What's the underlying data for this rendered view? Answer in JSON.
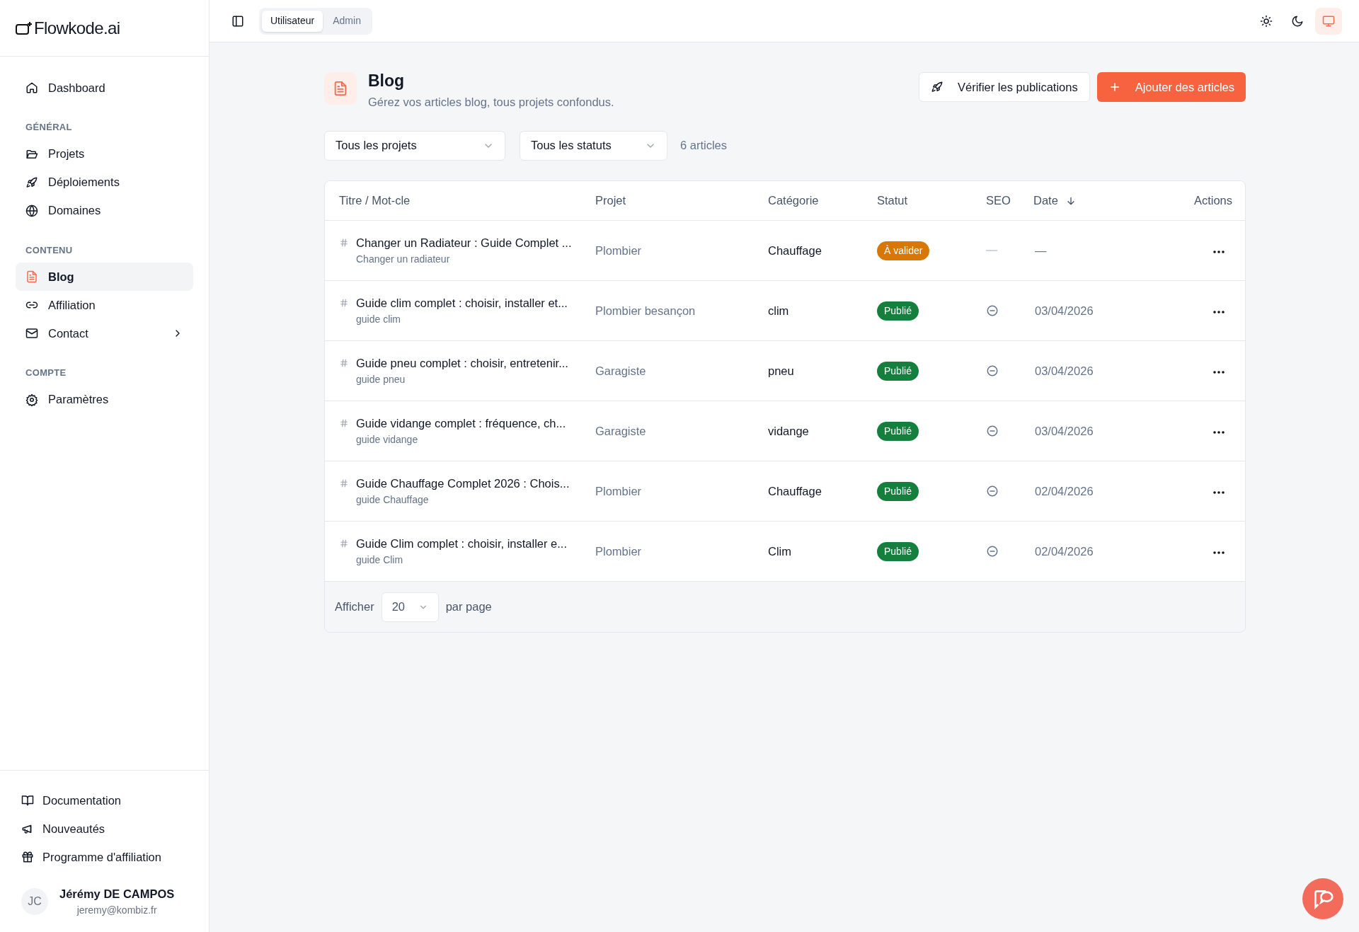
{
  "logo": "Flowkode.ai",
  "sidebar": {
    "top_item": {
      "label": "Dashboard",
      "selected": false
    },
    "sections": [
      {
        "heading": "GÉNÉRAL",
        "items": [
          {
            "label": "Projets",
            "selected": false,
            "has_submenu": false
          },
          {
            "label": "Déploiements",
            "selected": false,
            "has_submenu": false
          },
          {
            "label": "Domaines",
            "selected": false,
            "has_submenu": false
          }
        ]
      },
      {
        "heading": "CONTENU",
        "items": [
          {
            "label": "Blog",
            "selected": true,
            "has_submenu": false
          },
          {
            "label": "Affiliation",
            "selected": false,
            "has_submenu": false
          },
          {
            "label": "Contact",
            "selected": false,
            "has_submenu": true
          }
        ]
      },
      {
        "heading": "COMPTE",
        "items": [
          {
            "label": "Paramètres",
            "selected": false,
            "has_submenu": false
          }
        ]
      }
    ],
    "footer_links": [
      "Documentation",
      "Nouveautés",
      "Programme d'affiliation"
    ],
    "user": {
      "initials": "JC",
      "name": "Jérémy DE CAMPOS",
      "email": "jeremy@kombiz.fr"
    }
  },
  "topbar": {
    "role_tabs": [
      {
        "label": "Utilisateur",
        "selected": true
      },
      {
        "label": "Admin",
        "selected": false
      }
    ],
    "theme_buttons": [
      {
        "selected": false
      },
      {
        "selected": false
      },
      {
        "selected": true
      }
    ]
  },
  "page": {
    "title": "Blog",
    "subtitle": "Gérez vos articles blog, tous projets confondus.",
    "buttons": [
      "Vérifier les publications",
      "Ajouter des articles"
    ],
    "filters": [
      "Tous les projets",
      "Tous les statuts"
    ],
    "count": "6 articles"
  },
  "table": {
    "columns": [
      "Titre / Mot-cle",
      "Projet",
      "Catégorie",
      "Statut",
      "SEO",
      "Date",
      "Actions"
    ],
    "rows": [
      {
        "title": "Changer un Radiateur : Guide Complet ...",
        "keyword": "Changer un radiateur",
        "project": "Plombier",
        "category": "Chauffage",
        "status": {
          "label": "À valider",
          "kind": "pending"
        },
        "seo": {
          "kind": "none"
        },
        "date": "—"
      },
      {
        "title": "Guide clim complet : choisir, installer et...",
        "keyword": "guide clim",
        "project": "Plombier besançon",
        "category": "clim",
        "status": {
          "label": "Publié",
          "kind": "published"
        },
        "seo": {
          "kind": "neutral"
        },
        "date": "03/04/2026"
      },
      {
        "title": "Guide pneu complet : choisir, entretenir...",
        "keyword": "guide pneu",
        "project": "Garagiste",
        "category": "pneu",
        "status": {
          "label": "Publié",
          "kind": "published"
        },
        "seo": {
          "kind": "neutral"
        },
        "date": "03/04/2026"
      },
      {
        "title": "Guide vidange complet : fréquence, ch...",
        "keyword": "guide vidange",
        "project": "Garagiste",
        "category": "vidange",
        "status": {
          "label": "Publié",
          "kind": "published"
        },
        "seo": {
          "kind": "neutral"
        },
        "date": "03/04/2026"
      },
      {
        "title": "Guide Chauffage Complet 2026 : Chois...",
        "keyword": "guide Chauffage",
        "project": "Plombier",
        "category": "Chauffage",
        "status": {
          "label": "Publié",
          "kind": "published"
        },
        "seo": {
          "kind": "neutral"
        },
        "date": "02/04/2026"
      },
      {
        "title": "Guide Clim complet : choisir, installer e...",
        "keyword": "guide Clim",
        "project": "Plombier",
        "category": "Clim",
        "status": {
          "label": "Publié",
          "kind": "published"
        },
        "seo": {
          "kind": "neutral"
        },
        "date": "02/04/2026"
      }
    ],
    "footer": {
      "show_label": "Afficher",
      "page_size": "20",
      "per_page_label": "par page"
    }
  }
}
